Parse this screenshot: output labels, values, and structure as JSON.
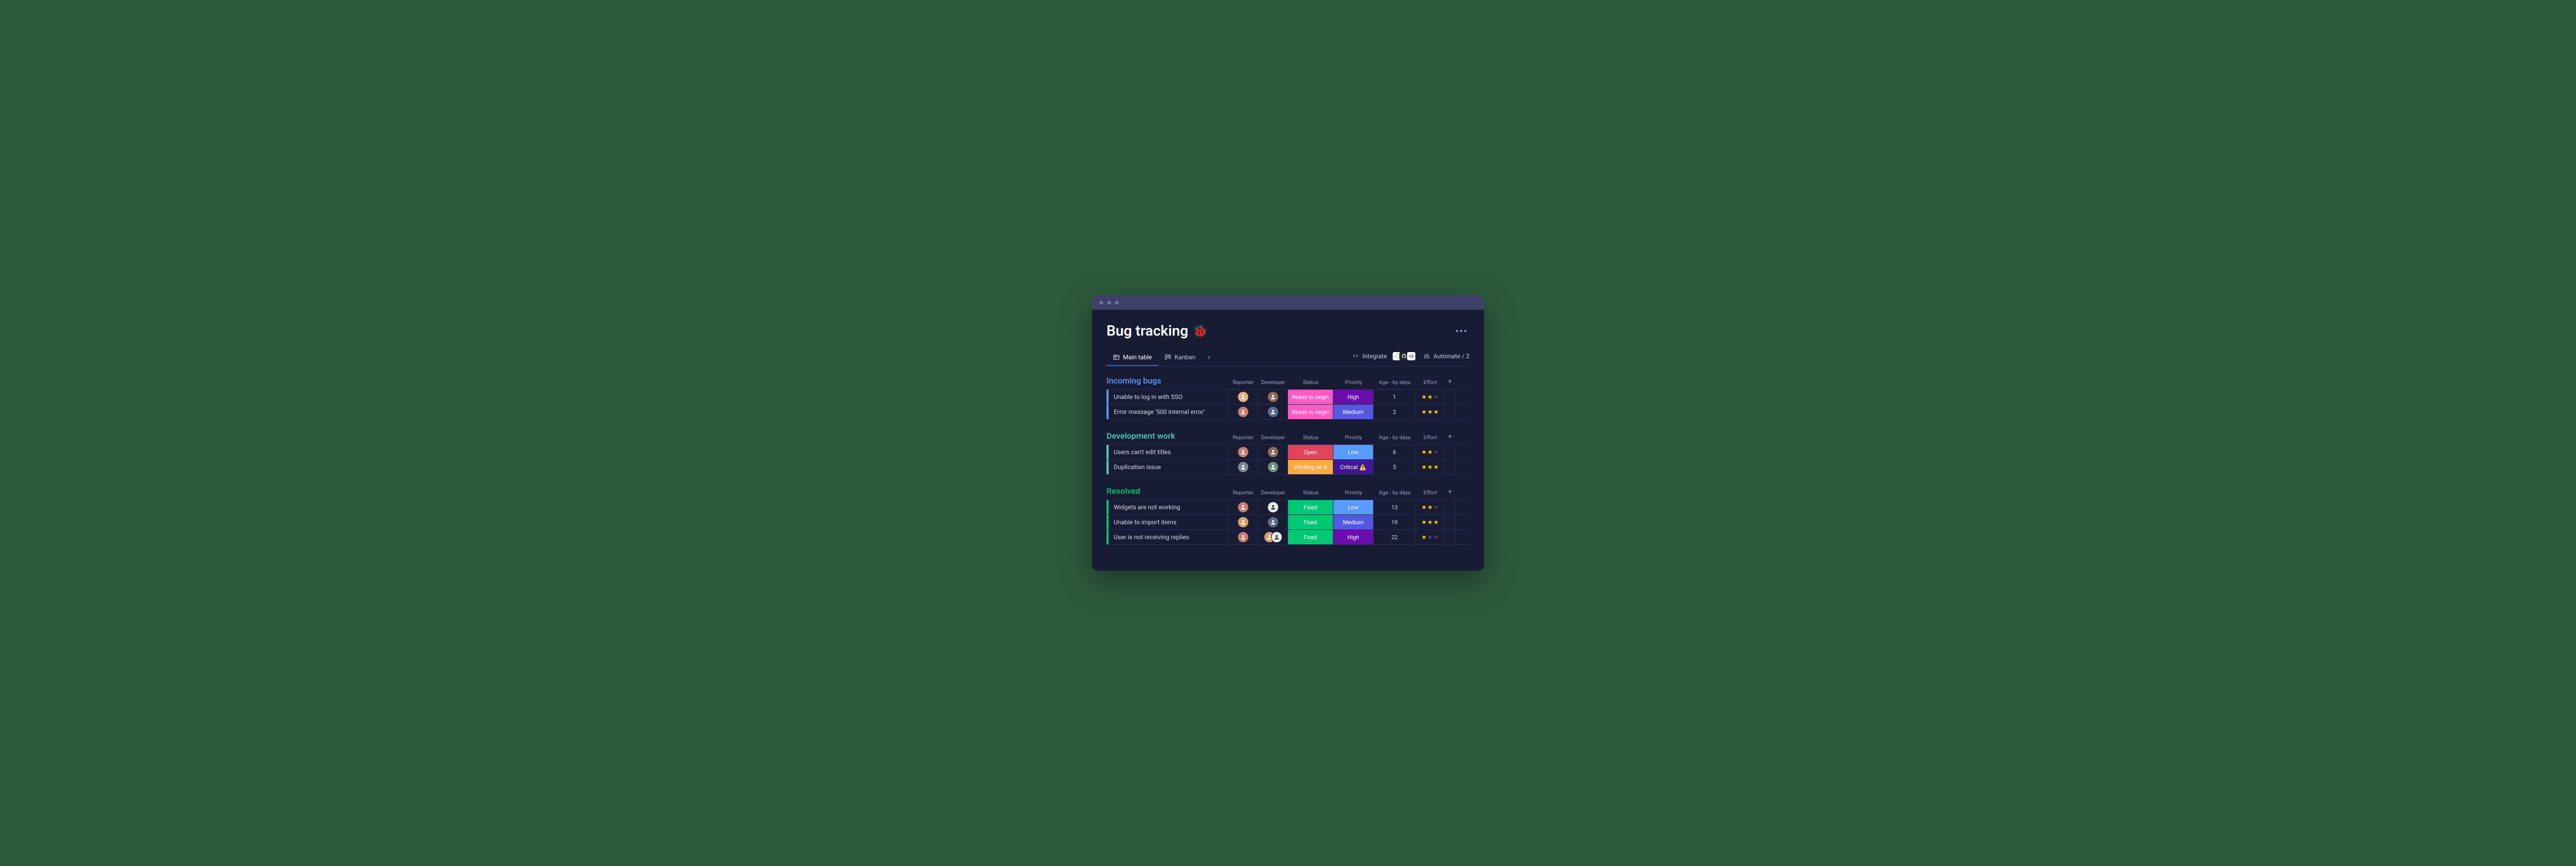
{
  "title": "Bug tracking",
  "emoji": "🐞",
  "tabs": [
    {
      "label": "Main table",
      "active": true
    },
    {
      "label": "Kanban",
      "active": false
    }
  ],
  "actions": {
    "integrate": "Integrate",
    "automate": "Automate / 2",
    "integration_more": "+2"
  },
  "columns": [
    "Reporter",
    "Developer",
    "Status",
    "Priority",
    "Age - by days",
    "Effort"
  ],
  "status_colors": {
    "Ready to begin": "#ff5ac4",
    "Open": "#e2445c",
    "Working on it": "#fdab3d",
    "Fixed": "#00c875"
  },
  "priority_colors": {
    "High": "#6a0dad",
    "Medium": "#5559df",
    "Low": "#579bfc",
    "Critical": "#401694"
  },
  "groups": [
    {
      "title": "Incoming bugs",
      "color": "#579bfc",
      "class": "g-blue",
      "items": [
        {
          "name": "Unable to log in with SSO",
          "reporter": {
            "bg": "#e8b07e"
          },
          "developer": {
            "bg": "#8e6a5a"
          },
          "status": "Ready to begin",
          "priority": "High",
          "age": "1",
          "effort": 2
        },
        {
          "name": "Error message '500 internal error'",
          "reporter": {
            "bg": "#c97b6d"
          },
          "developer": {
            "bg": "#5a6b8e"
          },
          "status": "Ready to begin",
          "priority": "Medium",
          "age": "2",
          "effort": 3
        }
      ]
    },
    {
      "title": "Development work",
      "color": "#4eccc6",
      "class": "g-teal",
      "items": [
        {
          "name": "Users can't edit titles",
          "reporter": {
            "bg": "#c97b6d"
          },
          "developer": {
            "bg": "#8e6a5a"
          },
          "status": "Open",
          "priority": "Low",
          "age": "6",
          "effort": 2
        },
        {
          "name": "Duplication issue",
          "reporter": {
            "bg": "#7a8699"
          },
          "developer": {
            "bg": "#6b8e7a"
          },
          "status": "Working on it",
          "priority": "Critical",
          "critical_icon": "⚠️",
          "age": "5",
          "effort": 3
        }
      ]
    },
    {
      "title": "Resolved",
      "color": "#00c875",
      "class": "g-green",
      "items": [
        {
          "name": "Widgets are not working",
          "reporter": {
            "bg": "#c97b6d"
          },
          "developer": {
            "bg": "#e8e8e8",
            "fg": "#333"
          },
          "status": "Fixed",
          "priority": "Low",
          "age": "13",
          "effort": 2
        },
        {
          "name": "Unable to import items",
          "reporter": {
            "bg": "#d9a06b"
          },
          "developer": {
            "bg": "#5a6b8e"
          },
          "status": "Fixed",
          "priority": "Medium",
          "age": "19",
          "effort": 3
        },
        {
          "name": "User is not receiving replies",
          "reporter": {
            "bg": "#c97b6d"
          },
          "developers": [
            {
              "bg": "#d9a06b"
            },
            {
              "bg": "#e8e8e8",
              "fg": "#333"
            }
          ],
          "status": "Fixed",
          "priority": "High",
          "age": "22",
          "effort": 1
        }
      ]
    }
  ]
}
